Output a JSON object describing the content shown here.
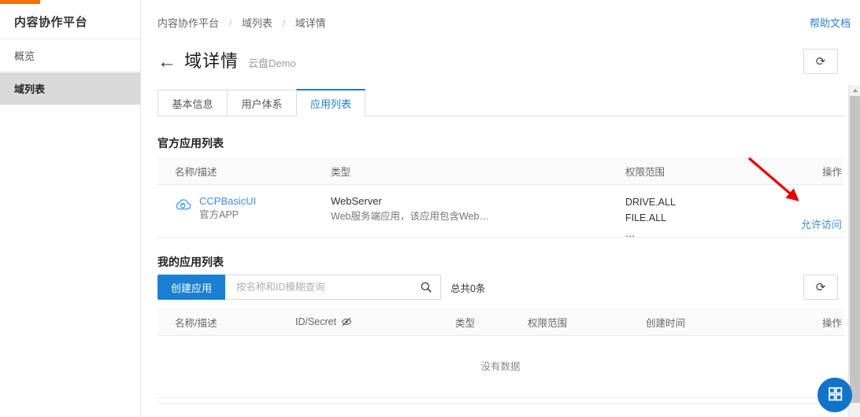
{
  "sidebar": {
    "brand": "内容协作平台",
    "items": [
      {
        "label": "概览",
        "selected": false
      },
      {
        "label": "域列表",
        "selected": true
      }
    ]
  },
  "header": {
    "breadcrumb": [
      "内容协作平台",
      "域列表",
      "域详情"
    ],
    "separator": "/",
    "help_link": "帮助文档",
    "back_icon": "←",
    "title": "域详情",
    "subtitle": "云盘Demo",
    "refresh_icon": "⟳"
  },
  "tabs": [
    {
      "label": "基本信息",
      "active": false
    },
    {
      "label": "用户体系",
      "active": false
    },
    {
      "label": "应用列表",
      "active": true
    }
  ],
  "official_section": {
    "title": "官方应用列表",
    "columns": [
      "名称/描述",
      "类型",
      "权限范围",
      "操作"
    ],
    "rows": [
      {
        "icon": "cloud-icon",
        "app_name": "CCPBasicUI",
        "app_desc": "官方APP",
        "type_name": "WebServer",
        "type_desc": "Web服务端应用，该应用包含Web…",
        "scopes": [
          "DRIVE.ALL",
          "FILE.ALL",
          "…"
        ],
        "action": "允许访问"
      }
    ]
  },
  "mine_section": {
    "title": "我的应用列表",
    "create_button": "创建应用",
    "search_placeholder": "按名称和ID模糊查询",
    "search_value": "",
    "search_icon": "search-icon",
    "total_text": "总共0条",
    "refresh_icon": "⟳",
    "columns": [
      "名称/描述",
      "ID/Secret",
      "类型",
      "权限范围",
      "创建时间",
      "操作"
    ],
    "id_secret_toggle_icon": "eye-off-icon",
    "empty_text": "没有数据",
    "rows": []
  },
  "fab": {
    "icon": "grid-icon",
    "label": ""
  },
  "colors": {
    "accent_orange": "#f2710a",
    "primary_blue": "#1b7fd4",
    "link_blue": "#3a8ee6",
    "selected_nav_bg": "#d9d9d9",
    "annotation_red": "#e60000",
    "fab_blue": "#1273ca"
  },
  "annotation": {
    "type": "arrow",
    "color": "#e60000",
    "points_to": "允许访问"
  }
}
